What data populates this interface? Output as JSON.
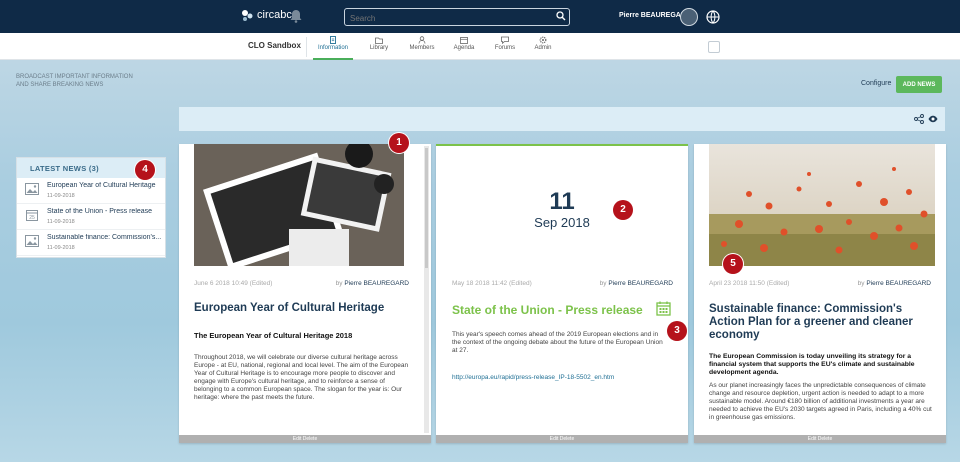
{
  "topbar": {
    "logo_text": "circabc",
    "search_placeholder": "Search",
    "user_name": "Pierre BEAUREGARD"
  },
  "subnav": {
    "space_title": "CLO Sandbox",
    "tabs": [
      {
        "label": "Information",
        "icon": "information-icon",
        "active": true
      },
      {
        "label": "Library",
        "icon": "library-icon"
      },
      {
        "label": "Members",
        "icon": "members-icon"
      },
      {
        "label": "Agenda",
        "icon": "agenda-icon"
      },
      {
        "label": "Forums",
        "icon": "forums-icon"
      },
      {
        "label": "Admin",
        "icon": "admin-icon"
      }
    ]
  },
  "page": {
    "intro_line1": "BROADCAST IMPORTANT INFORMATION",
    "intro_line2": "AND SHARE BREAKING NEWS",
    "configure_label": "Configure",
    "add_news_label": "ADD NEWS"
  },
  "latest_news": {
    "title": "LATEST NEWS (3)",
    "items": [
      {
        "title": "European Year of Cultural Heritage",
        "date": "11-09-2018",
        "icon": "image-icon"
      },
      {
        "title": "State of the Union - Press release",
        "date": "11-09-2018",
        "icon": "calendar-icon"
      },
      {
        "title": "Sustainable finance: Commission's...",
        "date": "11-09-2018",
        "icon": "image-icon"
      }
    ]
  },
  "cards": [
    {
      "meta": "June 6 2018 10:49 (Edited)",
      "by_prefix": "by",
      "author": "Pierre BEAUREGARD",
      "title": "European Year of Cultural Heritage",
      "subtitle": "The European Year of Cultural Heritage 2018",
      "body": "Throughout 2018, we will celebrate our diverse cultural heritage across Europe - at EU, national, regional and local level. The aim of the European Year of Cultural Heritage is to encourage more people to discover and engage with Europe's cultural heritage, and to reinforce a sense of belonging to a common European space. The slogan for the year is: Our heritage: where the past meets the future.",
      "footer": "Edit Delete"
    },
    {
      "day": "11",
      "month": "Sep 2018",
      "meta": "May 18 2018 11:42 (Edited)",
      "by_prefix": "by",
      "author": "Pierre BEAUREGARD",
      "title": "State of the Union - Press release",
      "body": "This year's speech comes ahead of the 2019 European elections and in the context of the ongoing debate about the future of the European Union at 27.",
      "link": "http://europa.eu/rapid/press-release_IP-18-5502_en.htm",
      "footer": "Edit Delete"
    },
    {
      "meta": "April 23 2018 11:50 (Edited)",
      "by_prefix": "by",
      "author": "Pierre BEAUREGARD",
      "title": "Sustainable finance: Commission's Action Plan for a greener and cleaner economy",
      "subtitle": "The European Commission is today unveiling its strategy for a financial system that supports the EU's climate and sustainable development agenda.",
      "body": "As our planet increasingly faces the unpredictable consequences of climate change and resource depletion, urgent action is needed to adapt to a more sustainable model. Around €180 billion of additional investments a year are needed to achieve the EU's 2030 targets agreed in Paris, including a 40% cut in greenhouse gas emissions.",
      "footer": "Edit Delete"
    }
  ],
  "callouts": [
    "1",
    "2",
    "3",
    "4",
    "5"
  ],
  "colors": {
    "navy": "#0f2a47",
    "accent_green": "#7cc24a",
    "button_green": "#5cb85c",
    "badge_red": "#b5121b"
  }
}
